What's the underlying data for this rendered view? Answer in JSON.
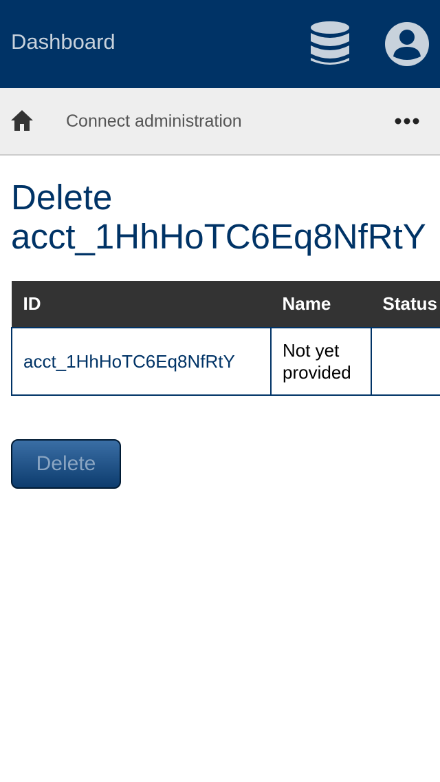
{
  "header": {
    "title": "Dashboard",
    "icons": [
      "database-icon",
      "account-icon"
    ]
  },
  "nav": {
    "home_icon": "home-icon",
    "link_label": "Connect administration",
    "more_icon": "more-icon"
  },
  "page": {
    "title": "Delete acct_1HhHoTC6Eq8NfRtY"
  },
  "table": {
    "columns": [
      "ID",
      "Name",
      "Status"
    ],
    "rows": [
      {
        "id": "acct_1HhHoTC6Eq8NfRtY",
        "name": "Not yet provided",
        "status": ""
      }
    ]
  },
  "actions": {
    "delete_label": "Delete"
  },
  "colors": {
    "header_bg": "#003366",
    "nav_bg": "#eeeeee",
    "table_header_bg": "#333333",
    "accent": "#003366"
  }
}
